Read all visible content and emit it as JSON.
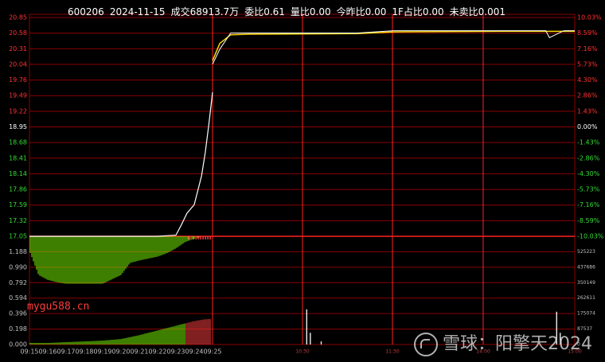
{
  "header": {
    "code": "600206",
    "date": "2024-11-15",
    "turnover": "成交68913.7万",
    "order_ratio": "委比0.61",
    "volume_ratio": "量比0.00",
    "today_yest_ratio": "今昨比0.00",
    "first_share_ratio": "1F占比0.00",
    "unsold_ratio": "未卖比0.001"
  },
  "watermarks": {
    "site": "mygu588.cn",
    "brand": "雪球：阳擎天2024"
  },
  "colors": {
    "background": "#000000",
    "grid": "#8b0000",
    "price_line": "#ffffff",
    "avg_line": "#ffd700",
    "up_label": "#ff3333",
    "down_label": "#33dd33",
    "neutral_label": "#ffffff",
    "axis_label": "#c0c0c0",
    "sell_bar": "#7cfc00",
    "buy_bar": "#ff4040"
  },
  "chart_data": {
    "type": "line",
    "title": "",
    "price_axis": {
      "ylim": [
        17.05,
        20.85
      ],
      "ticks": [
        "20.85",
        "20.58",
        "20.31",
        "20.04",
        "19.76",
        "19.49",
        "19.22",
        "18.95",
        "18.68",
        "18.41",
        "18.14",
        "17.86",
        "17.59",
        "17.32",
        "17.05"
      ],
      "pct_ticks": [
        "10.03%",
        "8.59%",
        "7.16%",
        "5.73%",
        "4.30%",
        "2.86%",
        "1.43%",
        "0.00%",
        "-1.43%",
        "-2.86%",
        "-4.30%",
        "-5.73%",
        "-7.16%",
        "-8.59%",
        "-10.03%"
      ],
      "prev_close": "18.95"
    },
    "volume_axis": {
      "left_ticks": [
        "1.188",
        "0.990",
        "0.792",
        "0.594",
        "0.396",
        "0.198",
        "0.000"
      ],
      "right_ticks": [
        "525223",
        "437686",
        "350149",
        "262611",
        "175074",
        "87537",
        "0"
      ]
    },
    "x_ticks": [
      "09:15",
      "09:16",
      "09:17",
      "09:18",
      "09:19",
      "09:20",
      "09:21",
      "09:22",
      "09:23",
      "09:24",
      "09:25",
      "10:30",
      "11:30",
      "14:00",
      "15:00"
    ],
    "auction_price": {
      "x": [
        0,
        1,
        2,
        3,
        4,
        5,
        6,
        7,
        8,
        8.3,
        8.6,
        9,
        9.2,
        9.4,
        9.6,
        9.8,
        10
      ],
      "values": [
        17.05,
        17.05,
        17.05,
        17.05,
        17.05,
        17.05,
        17.05,
        17.05,
        17.07,
        17.25,
        17.45,
        17.6,
        17.85,
        18.1,
        18.5,
        19.0,
        19.55
      ]
    },
    "session_price": {
      "x": [
        0,
        0.02,
        0.05,
        0.1,
        0.4,
        0.5,
        0.8,
        0.92,
        0.93,
        0.97,
        1
      ],
      "values": [
        20.04,
        20.3,
        20.58,
        20.58,
        20.58,
        20.62,
        20.62,
        20.62,
        20.5,
        20.62,
        20.62
      ]
    },
    "session_avg": {
      "x": [
        0,
        0.02,
        0.05,
        0.1,
        0.4,
        0.5,
        0.8,
        1
      ],
      "values": [
        20.1,
        20.4,
        20.55,
        20.56,
        20.57,
        20.6,
        20.61,
        20.61
      ]
    },
    "auction_unmatched": {
      "x": [
        0,
        0.5,
        1,
        1.5,
        2,
        3,
        4,
        5,
        5.5,
        6,
        6.5,
        7,
        7.5,
        8,
        8.5,
        9,
        9.5,
        10
      ],
      "values": [
        0.3,
        0.8,
        0.9,
        0.95,
        0.98,
        0.98,
        0.98,
        0.8,
        0.55,
        0.5,
        0.46,
        0.42,
        0.35,
        0.25,
        0.12,
        0.05,
        0.0,
        0.0
      ]
    },
    "auction_volume": {
      "x": [
        0,
        1,
        2,
        3,
        4,
        5,
        6,
        7,
        8,
        9,
        9.5,
        10
      ],
      "values": [
        0.02,
        0.02,
        0.03,
        0.04,
        0.05,
        0.07,
        0.12,
        0.18,
        0.24,
        0.3,
        0.32,
        0.33
      ]
    },
    "volume_spikes": [
      {
        "t": 0.26,
        "v": 0.45
      },
      {
        "t": 0.27,
        "v": 0.15
      },
      {
        "t": 0.3,
        "v": 0.04
      },
      {
        "t": 0.95,
        "v": 0.42
      },
      {
        "t": 0.96,
        "v": 0.15
      }
    ]
  }
}
